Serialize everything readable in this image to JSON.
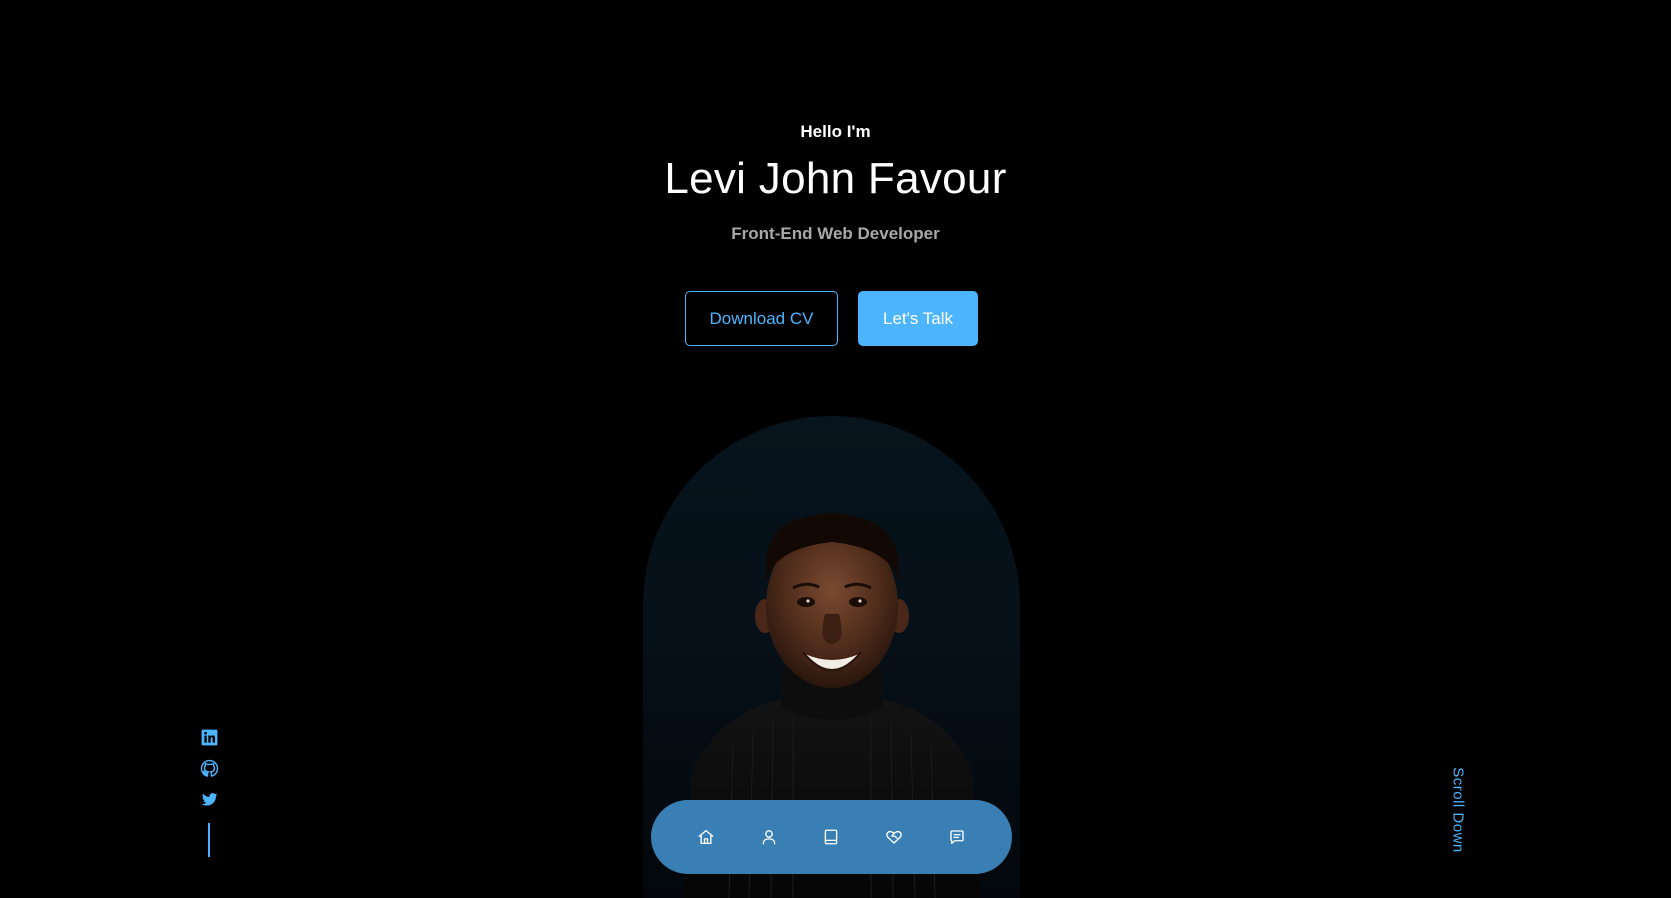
{
  "hero": {
    "greeting": "Hello I'm",
    "name": "Levi John Favour",
    "role": "Front-End Web Developer"
  },
  "actions": {
    "download_cv_label": "Download CV",
    "lets_talk_label": "Let's Talk"
  },
  "portrait": {
    "icon": "profile-photo"
  },
  "socials": {
    "items": [
      {
        "icon": "linkedin-icon"
      },
      {
        "icon": "github-icon"
      },
      {
        "icon": "twitter-icon"
      }
    ]
  },
  "scroll": {
    "label": "Scroll Down"
  },
  "nav": {
    "items": [
      {
        "icon": "home-icon"
      },
      {
        "icon": "user-icon"
      },
      {
        "icon": "book-icon"
      },
      {
        "icon": "heart-handshake-icon"
      },
      {
        "icon": "message-icon"
      }
    ]
  },
  "colors": {
    "background": "#000000",
    "accent": "#4db5ff",
    "nav_background": "#3a7fb3",
    "muted_text": "#a8a8a8"
  }
}
